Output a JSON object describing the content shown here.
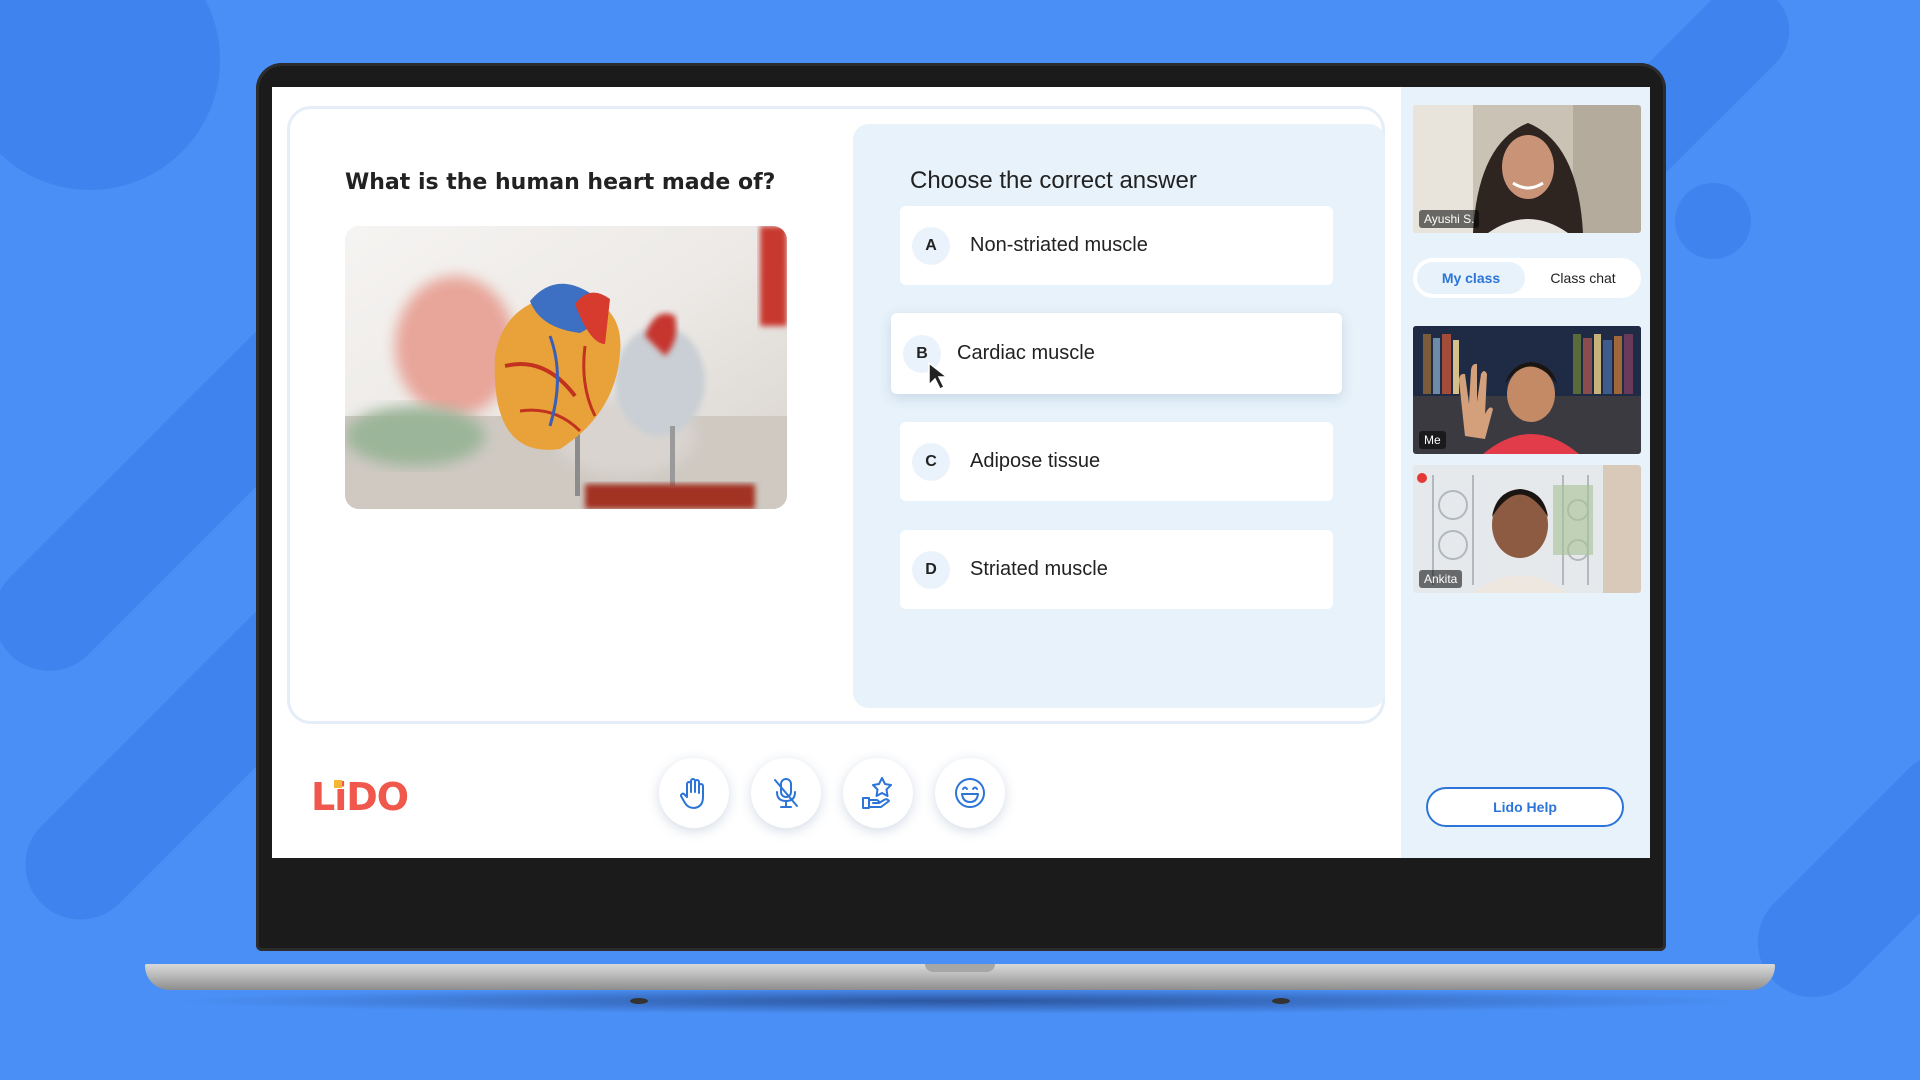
{
  "quiz": {
    "question": "What is the human heart made of?",
    "answers_title": "Choose the correct answer",
    "options": [
      {
        "letter": "A",
        "text": "Non-striated muscle"
      },
      {
        "letter": "B",
        "text": "Cardiac muscle"
      },
      {
        "letter": "C",
        "text": "Adipose tissue"
      },
      {
        "letter": "D",
        "text": "Striated muscle"
      }
    ],
    "selected_option": "B"
  },
  "brand": {
    "logo_text": "LiDO",
    "logo_color": "#f0584d"
  },
  "toolbar": {
    "icons": [
      "raise-hand-icon",
      "microphone-muted-icon",
      "reward-star-icon",
      "emoji-icon"
    ]
  },
  "sidebar": {
    "teacher_name": "Ayushi S.",
    "tabs": [
      "My class",
      "Class chat"
    ],
    "active_tab": "My class",
    "participants": [
      {
        "name": "Me"
      },
      {
        "name": "Ankita"
      }
    ],
    "help_label": "Lido Help"
  },
  "colors": {
    "background": "#4a8ff5",
    "accent": "#2c74d8",
    "panel": "#e7f2fa"
  }
}
